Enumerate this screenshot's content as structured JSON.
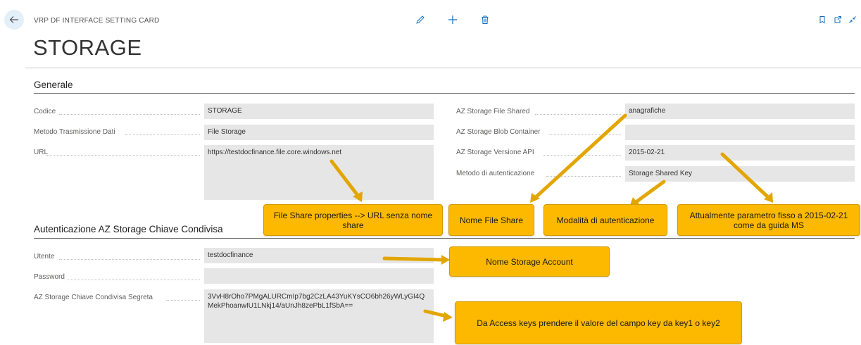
{
  "header": {
    "caption": "VRP DF INTERFACE SETTING CARD",
    "title": "STORAGE"
  },
  "sections": {
    "general": {
      "title": "Generale",
      "left_fields": [
        {
          "label": "Codice",
          "value": "STORAGE"
        },
        {
          "label": "Metodo Trasmissione Dati",
          "value": "File Storage"
        },
        {
          "label": "URL",
          "value": "https://testdocfinance.file.core.windows.net"
        }
      ],
      "right_fields": [
        {
          "label": "AZ Storage File Shared",
          "value": "anagrafiche"
        },
        {
          "label": "AZ Storage Blob Container",
          "value": ""
        },
        {
          "label": "AZ Storage Versione API",
          "value": "2015-02-21"
        },
        {
          "label": "Metodo di autenticazione",
          "value": "Storage Shared Key"
        }
      ]
    },
    "auth": {
      "title": "Autenticazione AZ Storage Chiave Condivisa",
      "fields": [
        {
          "label": "Utente",
          "value": "testdocfinance"
        },
        {
          "label": "Password",
          "value": ""
        },
        {
          "label": "AZ Storage Chiave Condivisa Segreta",
          "value": "3VvH8rOho7PMgALURCmIp7bg2CzLA43YuKYsCO6bh26yWLyGI4QMekPhoanwIU1LNkj14/aUnJh8zePbL1fSbA=="
        }
      ]
    }
  },
  "callouts": {
    "url": "File Share properties --> URL senza nome share",
    "file_share": "Nome File Share",
    "auth_mode": "Modalità di autenticazione",
    "api_version": "Attualmente parametro fisso a 2015-02-21 come da guida MS",
    "storage_account": "Nome Storage Account",
    "access_keys": "Da Access keys prendere il valore del campo key da key1 o key2"
  },
  "icons": {
    "back": "back-arrow-icon",
    "edit": "pencil-icon",
    "add": "plus-icon",
    "delete": "trash-icon",
    "bookmark": "bookmark-icon",
    "open_new": "open-in-new-window-icon",
    "collapse": "collapse-icon"
  },
  "colors": {
    "accent": "#0f6cbd",
    "callout": "#fdb900",
    "field_bg": "#e6e6e6"
  }
}
